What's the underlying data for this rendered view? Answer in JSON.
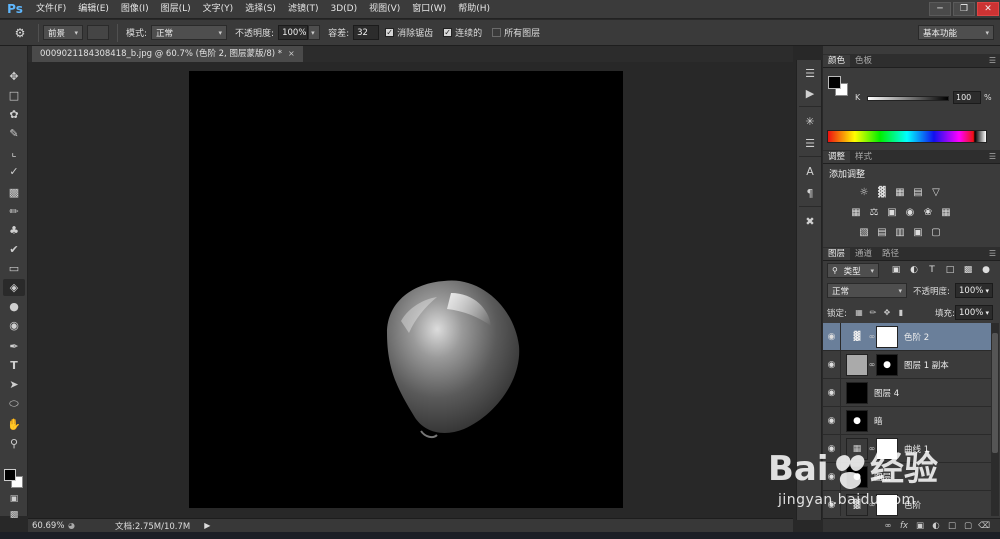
{
  "app": {
    "logo": "Ps"
  },
  "menu": [
    "文件(F)",
    "编辑(E)",
    "图像(I)",
    "图层(L)",
    "文字(Y)",
    "选择(S)",
    "滤镜(T)",
    "3D(D)",
    "视图(V)",
    "窗口(W)",
    "帮助(H)"
  ],
  "window_controls": {
    "minimize": "─",
    "restore": "❐",
    "close": "✕"
  },
  "options": {
    "tool_icon": "paint-bucket-icon",
    "source_select": "前景",
    "mode_label": "模式:",
    "mode_value": "正常",
    "opacity_label": "不透明度:",
    "opacity_value": "100%",
    "tolerance_label": "容差:",
    "tolerance_value": "32",
    "antialias_label": "消除锯齿",
    "antialias_checked": true,
    "contiguous_label": "连续的",
    "contiguous_checked": true,
    "all_layers_label": "所有图层",
    "all_layers_checked": false,
    "workspace": "基本功能"
  },
  "document": {
    "tab_title": "0009021184308418_b.jpg @ 60.7% (色阶 2, 图层蒙版/8) *",
    "tab_close": "×"
  },
  "status": {
    "zoom": "60.69%",
    "doc_info": "文档:2.75M/10.7M"
  },
  "color_panel": {
    "tabs": [
      "颜色",
      "色板"
    ],
    "channel_label": "K",
    "channel_value": "100",
    "channel_unit": "%"
  },
  "adjustments_panel": {
    "tabs": [
      "调整",
      "样式"
    ],
    "title": "添加调整"
  },
  "layers_panel": {
    "tabs": [
      "图层",
      "通道",
      "路径"
    ],
    "kind_filter": "类型",
    "blend_mode": "正常",
    "opacity_label": "不透明度:",
    "opacity_value": "100%",
    "lock_label": "锁定:",
    "fill_label": "填充:",
    "fill_value": "100%",
    "layers": [
      {
        "name": "色阶 2",
        "selected": true,
        "visible": true
      },
      {
        "name": "图层 1 副本",
        "selected": false,
        "visible": true
      },
      {
        "name": "图层 4",
        "selected": false,
        "visible": true
      },
      {
        "name": "暗",
        "selected": false,
        "visible": true
      },
      {
        "name": "曲线 1",
        "selected": false,
        "visible": true
      },
      {
        "name": "图层",
        "selected": false,
        "visible": true
      },
      {
        "name": "色阶",
        "selected": false,
        "visible": true
      }
    ]
  },
  "watermark": {
    "text": "jingyan.baidu.com"
  }
}
